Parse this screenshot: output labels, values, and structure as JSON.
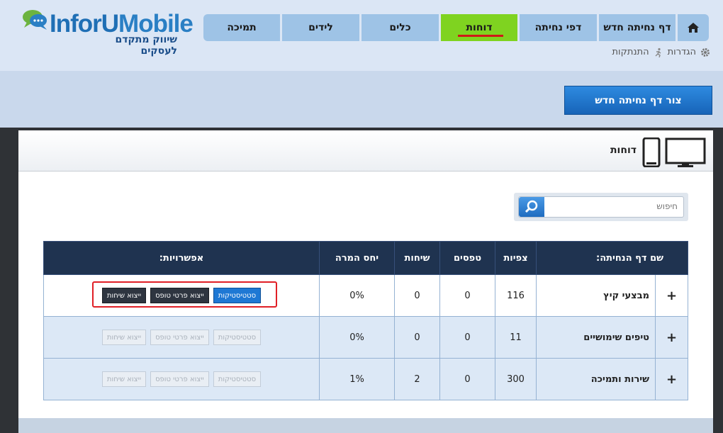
{
  "brand": {
    "logo_main_a": "InforU",
    "logo_main_b": "Mobile",
    "tagline": "שיווק מתקדם לעסקים"
  },
  "nav": {
    "items": [
      {
        "label": "תמיכה"
      },
      {
        "label": "לידים"
      },
      {
        "label": "כלים"
      },
      {
        "label": "דוחות",
        "active": true
      },
      {
        "label": "דפי נחיתה"
      },
      {
        "label": "דף נחיתה חדש"
      }
    ],
    "home_icon": "home-icon"
  },
  "sub_links": {
    "settings": "הגדרות",
    "logout": "התנתקות"
  },
  "toolbar": {
    "create_label": "צור דף נחיתה חדש"
  },
  "panel": {
    "title": "דוחות"
  },
  "search": {
    "placeholder": "חיפוש"
  },
  "table": {
    "headers": {
      "name": "שם דף הנחיתה:",
      "views": "צפיות",
      "forms": "טפסים",
      "calls": "שיחות",
      "conversion": "יחס המרה",
      "options": "אפשרויות:"
    },
    "actions": {
      "stats": "סטטיסטיקות",
      "export_forms": "ייצוא פרטי טופס",
      "export_calls": "ייצוא שיחות"
    },
    "rows": [
      {
        "name": "מבצעי קיץ",
        "views": "116",
        "forms": "0",
        "calls": "0",
        "conversion": "0%"
      },
      {
        "name": "טיפים שימושיים",
        "views": "11",
        "forms": "0",
        "calls": "0",
        "conversion": "0%"
      },
      {
        "name": "שירות ותמיכה",
        "views": "300",
        "forms": "0",
        "calls": "2",
        "conversion": "1%"
      }
    ]
  },
  "colors": {
    "nav_active": "#7fd320",
    "nav_default": "#9ec3e6",
    "header_bg": "#dbe6f5",
    "table_head": "#1f3350",
    "primary_button": "#1e78d4",
    "highlight": "#e01f26"
  }
}
